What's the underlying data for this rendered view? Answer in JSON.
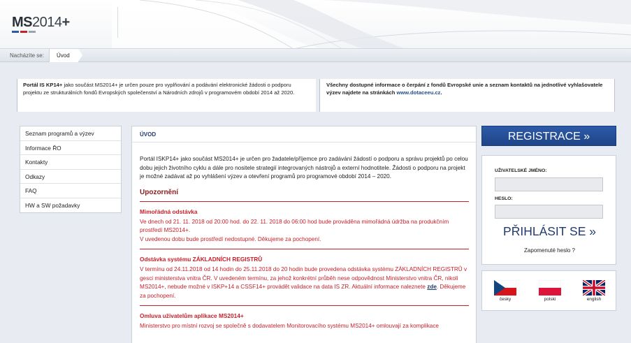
{
  "header": {
    "logo_ms": "MS",
    "logo_year": "2014",
    "logo_plus": "+"
  },
  "breadcrumb": {
    "label": "Nacházíte se:",
    "current": "Úvod"
  },
  "info": {
    "left_bold": "Portál IS KP14+",
    "left_text": " jako součást MS2014+ je určen pouze pro vyplňování a podávání elektronické žádosti o podporu projektu ze strukturálních fondů Evropských společenství a Národních zdrojů v programovém období 2014 až 2020.",
    "right_text": "Všechny dostupné informace o čerpání z fondů Evropské unie a seznam kontaktů na jednotlivé vyhlašovatele výzev najdete na stránkách ",
    "right_link": "www.dotaceeu.cz",
    "right_end": "."
  },
  "menu": {
    "items": [
      "Seznam programů a výzev",
      "Informace ŘO",
      "Kontakty",
      "Odkazy",
      "FAQ",
      "HW a SW požadavky"
    ]
  },
  "main": {
    "title": "ÚVOD",
    "intro": "Portál ISKP14+ jako součást MS2014+ je určen pro žadatele/příjemce pro zadávání žádostí o podporu a správu projektů po celou dobu jejich životního cyklu a dále pro nositele strategií integrovaných nástrojů a externí hodnotitele. Žádosti o podporu na projekt je možné zadávat až po vyhlášení výzev a otevření programů pro programové období 2014 – 2020.",
    "notices_heading": "Upozornění",
    "notices": [
      {
        "title": "Mimořádná odstávka",
        "text1": "Ve dnech od 21. 11. 2018 od 20:00 hod. do 22. 11. 2018 do 06:00 hod bude prováděna mimořádná údržba na produkčním prostředí MS2014+.",
        "text2": "V uvedenou dobu bude prostředí nedostupné. Děkujeme za pochopení."
      },
      {
        "title": "Odstávka systému ZÁKLADNÍCH REGISTRŮ",
        "text1": "V termínu od 24.11.2018 od 14 hodin do 25.11.2018 do 20 hodin bude provedena odstávka systému ZÁKLADNÍCH REGISTRŮ v gesci ministerstva vnitra ČR. V uvedeném termínu, za jehož konkrétní průběh nese odpovědnost Ministerstvo vnitra ČR, nikoli MS2014+, nebude možné v ISKP+14 a CSSF14+ provádět validace na data IS ZR. Aktuální informace naleznete ",
        "link": "zde",
        "text2": ". Děkujeme za pochopení."
      },
      {
        "title": "Omluva uživatelům aplikace MS2014+",
        "text1": "Ministerstvo pro místní rozvoj se společně s dodavatelem Monitorovacího systému MS2014+ omlouvají za komplikace"
      }
    ]
  },
  "register": {
    "label": "REGISTRACE »"
  },
  "login": {
    "username_label": "UŽIVATELSKÉ JMÉNO:",
    "password_label": "HESLO:",
    "button": "PŘIHLÁSIT SE »",
    "forgot": "Zapomenuté heslo ?"
  },
  "languages": [
    {
      "label": "česky",
      "icon": "czech-flag-icon"
    },
    {
      "label": "polski",
      "icon": "polish-flag-icon"
    },
    {
      "label": "english",
      "icon": "uk-flag-icon"
    }
  ],
  "colors": {
    "accent_blue": "#1f4488",
    "notice_red": "#c8202a",
    "logo_blue": "#2d5aa8",
    "logo_red": "#c8202a"
  }
}
